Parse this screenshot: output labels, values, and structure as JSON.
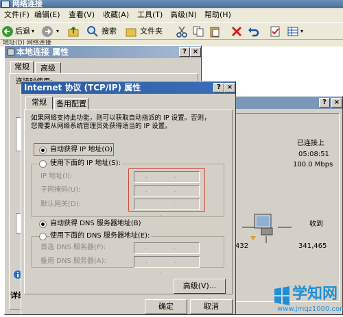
{
  "window": {
    "title": "网络连接"
  },
  "menu": [
    "文件(F)",
    "编辑(E)",
    "查看(V)",
    "收藏(A)",
    "工具(T)",
    "高级(N)",
    "帮助(H)"
  ],
  "toolbar": {
    "back": "后退",
    "search": "搜索",
    "folders": "文件夹"
  },
  "address": "地址(D) 网络连接",
  "local_props": {
    "title": "本地连接 属性",
    "tabs": [
      "常规",
      "高级"
    ],
    "connect_using": "连接时使用:",
    "help": "?",
    "close": "×"
  },
  "status_window": {
    "connected": "已连接上",
    "duration": "05:08:51",
    "speed": "100.0 Mbps",
    "received_label": "收到",
    "sent_value": "432",
    "received_value": "341,465",
    "details_label": "详细",
    "close": "×",
    "help": "?"
  },
  "tcpip": {
    "title": "Internet 协议 (TCP/IP) 属性",
    "help": "?",
    "close": "×",
    "tabs": [
      "常规",
      "备用配置"
    ],
    "description": "如果网络支持此功能，则可以获取自动指派的 IP 设置。否则，您需要从网络系统管理员处获得适当的 IP 设置。",
    "auto_ip": "自动获得 IP 地址(O)",
    "manual_ip": "使用下面的 IP 地址(S):",
    "ip_address": "IP 地址(I):",
    "subnet_mask": "子网掩码(U):",
    "gateway": "默认网关(D):",
    "auto_dns": "自动获得 DNS 服务器地址(B)",
    "manual_dns": "使用下面的 DNS 服务器地址(E):",
    "pref_dns": "首选 DNS 服务器(P):",
    "alt_dns": "备用 DNS 服务器(A):",
    "ip_placeholder": ".    .    .",
    "advanced": "高级(V)...",
    "ok": "确定",
    "cancel": "取消"
  },
  "watermark": {
    "logo": "学知网",
    "url": "www.jmqz1000.com"
  },
  "colors": {
    "title_active": "#1c4f9a",
    "title_inactive": "#7a96b8",
    "highlight": "#d04a3a"
  }
}
